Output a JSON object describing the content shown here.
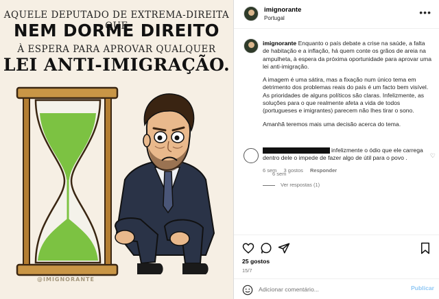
{
  "post_image": {
    "line1": "AQUELE DEPUTADO DE EXTREMA-DIREITA QUE",
    "line2": "NEM DORME DIREITO",
    "line3": "À ESPERA PARA APROVAR QUALQUER",
    "line4": "LEI ANTI-IMIGRAÇÃO.",
    "watermark": "@IMIGNORANTE",
    "colors": {
      "background": "#f6efe4",
      "sand": "#7cc242",
      "frame": "#c99646",
      "suit": "#2a3347"
    }
  },
  "header": {
    "username": "imignorante",
    "location": "Portugal",
    "more_icon": "more-horizontal-icon"
  },
  "caption": {
    "username": "imignorante",
    "paragraph1": "Enquanto o país debate a crise na saúde, a falta de habitação e a inflação, há quem conte os grãos de areia na ampulheta, à espera da próxima oportunidade para aprovar uma lei anti-imigração.",
    "paragraph2": "A imagem é uma sátira, mas a fixação num único tema em detrimento dos problemas reais do país é um facto bem visível. As prioridades de alguns políticos são claras. Infelizmente, as soluções para o que realmente afeta a vida de todos (portugueses e imigrantes) parecem não lhes tirar o sono.",
    "paragraph3": "Amanhã teremos mais uma decisão acerca do tema.",
    "time": "6 sem"
  },
  "comment": {
    "text": "infelizmente o ódio que ele carrega dentro dele o impede de fazer algo de útil para o povo .",
    "time": "6 sem",
    "likes": "3 gostos",
    "reply_label": "Responder",
    "view_replies": "Ver respostas (1)"
  },
  "actions": {
    "likes": "25 gostos",
    "date": "15/7"
  },
  "compose": {
    "placeholder": "Adicionar comentário...",
    "publish_label": "Publicar",
    "accent": "#8fc7f4"
  }
}
